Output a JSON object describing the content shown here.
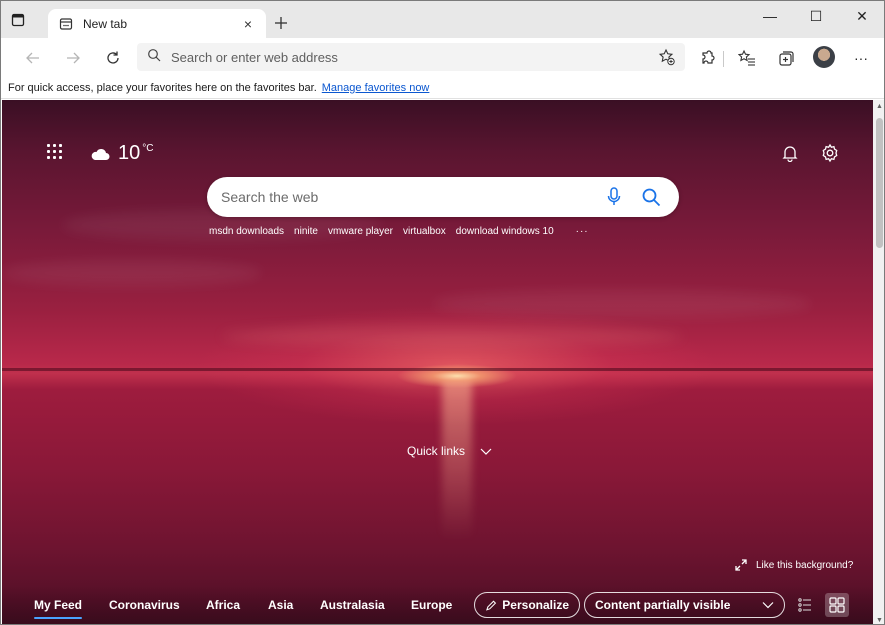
{
  "tab": {
    "title": "New tab",
    "close_glyph": "×"
  },
  "window": {
    "minimize_glyph": "—",
    "maximize_glyph": "☐",
    "close_glyph": "✕"
  },
  "toolbar": {
    "address_placeholder": "Search or enter web address",
    "more_glyph": "···"
  },
  "favorites_bar": {
    "message": "For quick access, place your favorites here on the favorites bar.",
    "link": "Manage favorites now"
  },
  "weather": {
    "temp": "10",
    "unit": "°C",
    "icon": "cloud-icon"
  },
  "search": {
    "placeholder": "Search the web"
  },
  "trending": [
    "msdn downloads",
    "ninite",
    "vmware player",
    "virtualbox",
    "download windows 10"
  ],
  "trending_more": "···",
  "quick_links": {
    "label": "Quick links"
  },
  "background": {
    "like_label": "Like this background?"
  },
  "feed": {
    "tabs": [
      "My Feed",
      "Coronavirus",
      "Africa",
      "Asia",
      "Australasia",
      "Europe"
    ],
    "personalize": "Personalize",
    "visibility": "Content partially visible"
  },
  "colors": {
    "accent": "#4aa3ff",
    "link": "#0b57d0",
    "search_icon": "#1a73e8"
  }
}
